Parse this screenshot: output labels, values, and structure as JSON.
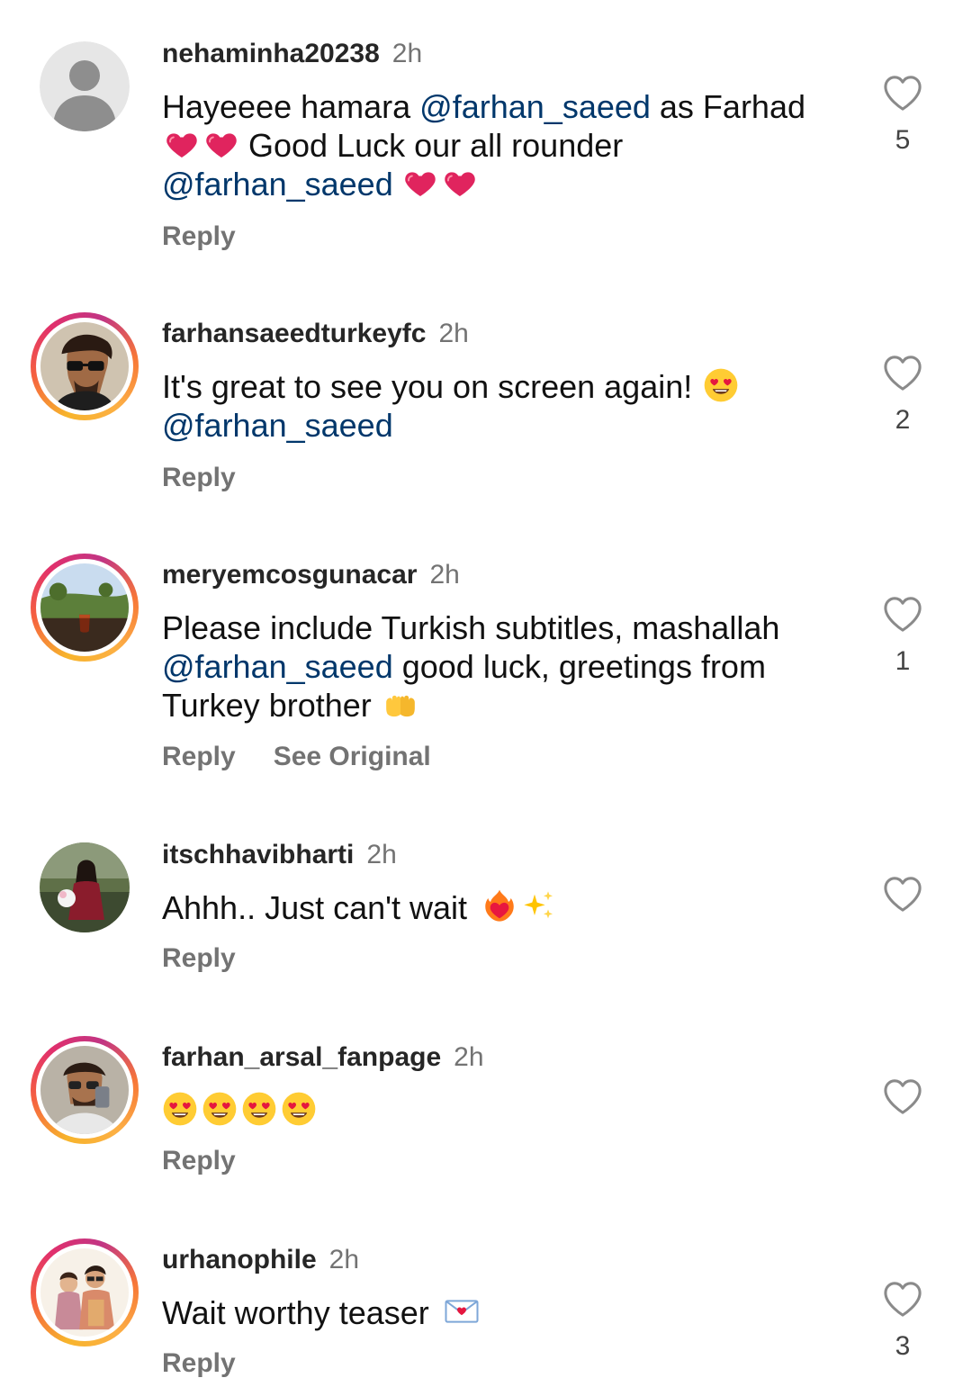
{
  "comments": [
    {
      "username": "nehaminha20238",
      "time": "2h",
      "text_parts": [
        "Hayeeee hamara ",
        "@farhan_saeed",
        " as Farhad",
        "Good Luck our all rounder",
        "@farhan_saeed"
      ],
      "reply": "Reply",
      "likes": "5"
    },
    {
      "username": "farhansaeedturkeyfc",
      "time": "2h",
      "text_parts": [
        "It's great to see you on screen again! ",
        "@farhan_saeed"
      ],
      "reply": "Reply",
      "likes": "2"
    },
    {
      "username": "meryemcosgunacar",
      "time": "2h",
      "text_parts": [
        "Please include Turkish subtitles, mashallah",
        "@farhan_saeed",
        " good luck, greetings from",
        "Turkey brother "
      ],
      "reply": "Reply",
      "see_original": "See Original",
      "likes": "1"
    },
    {
      "username": "itschhavibharti",
      "time": "2h",
      "text_parts": [
        "Ahhh.. Just can't wait "
      ],
      "reply": "Reply",
      "likes": ""
    },
    {
      "username": "farhan_arsal_fanpage",
      "time": "2h",
      "text_parts": [],
      "reply": "Reply",
      "likes": ""
    },
    {
      "username": "urhanophile",
      "time": "2h",
      "text_parts": [
        "Wait worthy teaser "
      ],
      "reply": "Reply",
      "likes": "3"
    }
  ],
  "icons": {
    "like": "heart-outline-icon",
    "emojis": [
      "red-heart",
      "heart-eyes",
      "palms-up-together",
      "heart-on-fire",
      "sparkles",
      "love-letter"
    ]
  },
  "colors": {
    "mention": "#00376b",
    "secondary_text": "#737373",
    "username": "#262626"
  }
}
